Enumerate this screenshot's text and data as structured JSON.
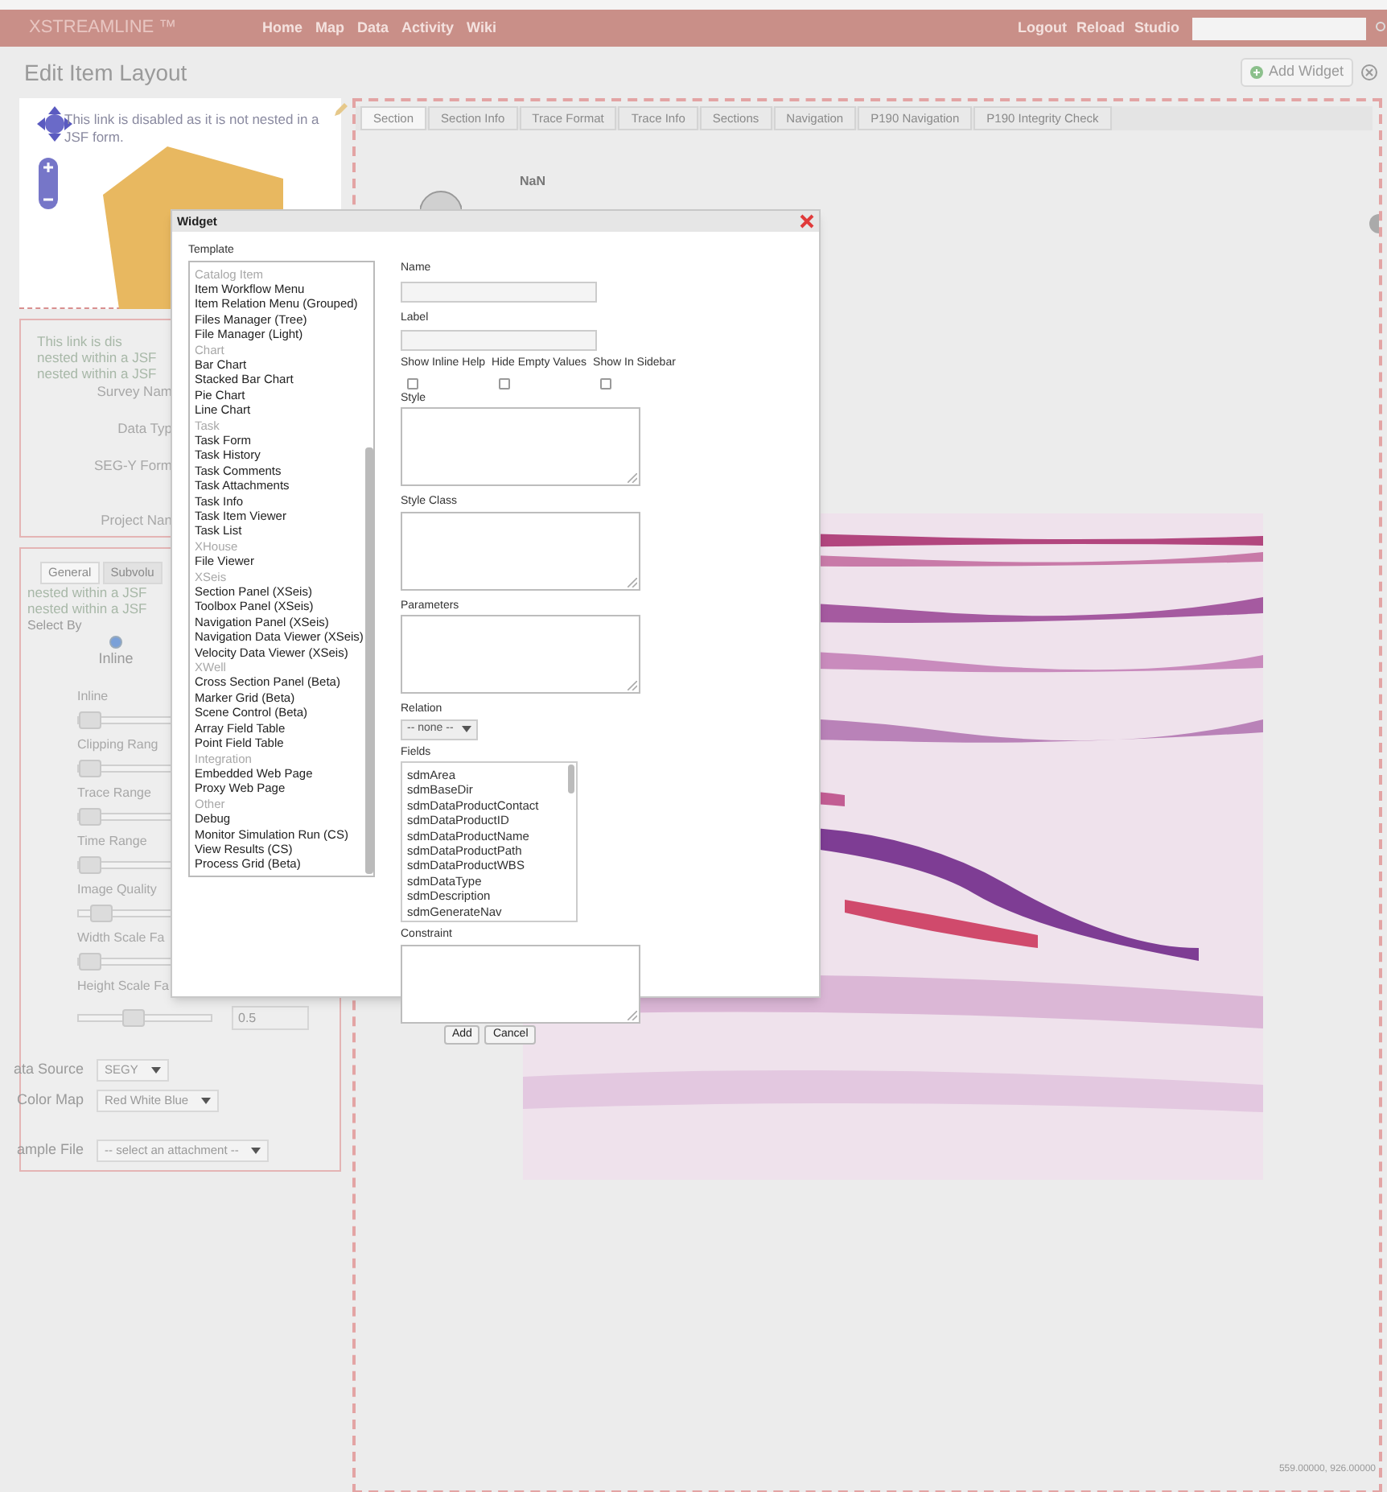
{
  "top_bar": {
    "logo": "XSTREAMLINE ™",
    "nav": [
      "Home",
      "Map",
      "Data",
      "Activity",
      "Wiki"
    ],
    "links": [
      "Logout",
      "Reload",
      "Studio"
    ]
  },
  "header": {
    "title": "Edit Item Layout",
    "add_widget": "Add Widget"
  },
  "map_panel": {
    "notice": "This link is disabled as it is not nested in a JSF form."
  },
  "info_panel": {
    "notices": [
      "This link is dis",
      "nested within a JSF",
      "nested within a JSF"
    ],
    "fields": [
      "Survey Nam",
      "Data Typ",
      "SEG-Y Form",
      "Project Nan"
    ]
  },
  "controls_panel": {
    "tabs": [
      {
        "label": "General",
        "selected": true
      },
      {
        "label": "Subvolu",
        "selected": false
      }
    ],
    "notices": [
      "nested within a JSF",
      "nested within a JSF"
    ],
    "select_by": "Select By",
    "radio": {
      "label": "Inline",
      "selected": true
    },
    "sliders": [
      {
        "label": "Inline",
        "level": 0
      },
      {
        "label": "Clipping Rang",
        "level": 0
      },
      {
        "label": "Trace Range",
        "level": 0
      },
      {
        "label": "Time Range",
        "level": 0
      },
      {
        "label": "Image Quality",
        "level": 0.1
      },
      {
        "label": "Width Scale Fa",
        "level": 0
      },
      {
        "label": "Height Scale Fa",
        "level": 0.4,
        "reading": "0.5"
      }
    ],
    "selects": [
      {
        "label": "ata Source",
        "value": "SEGY"
      },
      {
        "label": "Color Map",
        "value": "Red White Blue"
      },
      {
        "label": "ample File",
        "value": "-- select an attachment --"
      }
    ]
  },
  "section_panel": {
    "tabs": [
      {
        "label": "Section",
        "selected": true
      },
      {
        "label": "Section Info",
        "selected": false
      },
      {
        "label": "Trace Format",
        "selected": false
      },
      {
        "label": "Trace Info",
        "selected": false
      },
      {
        "label": "Sections",
        "selected": false
      },
      {
        "label": "Navigation",
        "selected": false
      },
      {
        "label": "P190 Navigation",
        "selected": false
      },
      {
        "label": "P190 Integrity Check",
        "selected": false
      }
    ],
    "value": "NaN",
    "coords": "559.00000, 926.00000"
  },
  "dialog": {
    "title": "Widget",
    "template_label": "Template",
    "templates": [
      {
        "kind": "group",
        "label": "Catalog Item"
      },
      {
        "kind": "item",
        "label": "Item Workflow Menu"
      },
      {
        "kind": "item",
        "label": "Item Relation Menu (Grouped)"
      },
      {
        "kind": "item",
        "label": "Files Manager (Tree)"
      },
      {
        "kind": "item",
        "label": "File Manager (Light)"
      },
      {
        "kind": "group",
        "label": "Chart"
      },
      {
        "kind": "item",
        "label": "Bar Chart"
      },
      {
        "kind": "item",
        "label": "Stacked Bar Chart"
      },
      {
        "kind": "item",
        "label": "Pie Chart"
      },
      {
        "kind": "item",
        "label": "Line Chart"
      },
      {
        "kind": "group",
        "label": "Task"
      },
      {
        "kind": "item",
        "label": "Task Form"
      },
      {
        "kind": "item",
        "label": "Task History"
      },
      {
        "kind": "item",
        "label": "Task Comments"
      },
      {
        "kind": "item",
        "label": "Task Attachments"
      },
      {
        "kind": "item",
        "label": "Task Info"
      },
      {
        "kind": "item",
        "label": "Task Item Viewer"
      },
      {
        "kind": "item",
        "label": "Task List"
      },
      {
        "kind": "group",
        "label": "XHouse"
      },
      {
        "kind": "item",
        "label": "File Viewer"
      },
      {
        "kind": "group",
        "label": "XSeis"
      },
      {
        "kind": "item",
        "label": "Section Panel (XSeis)"
      },
      {
        "kind": "item",
        "label": "Toolbox Panel (XSeis)"
      },
      {
        "kind": "item",
        "label": "Navigation Panel (XSeis)"
      },
      {
        "kind": "item",
        "label": "Navigation Data Viewer (XSeis)"
      },
      {
        "kind": "item",
        "label": "Velocity Data Viewer (XSeis)"
      },
      {
        "kind": "group",
        "label": "XWell"
      },
      {
        "kind": "item",
        "label": "Cross Section Panel (Beta)"
      },
      {
        "kind": "item",
        "label": "Marker Grid (Beta)"
      },
      {
        "kind": "item",
        "label": "Scene Control (Beta)"
      },
      {
        "kind": "item",
        "label": "Array Field Table"
      },
      {
        "kind": "item",
        "label": "Point Field Table"
      },
      {
        "kind": "group",
        "label": "Integration"
      },
      {
        "kind": "item",
        "label": "Embedded Web Page"
      },
      {
        "kind": "item",
        "label": "Proxy Web Page"
      },
      {
        "kind": "group",
        "label": "Other"
      },
      {
        "kind": "item",
        "label": "Debug"
      },
      {
        "kind": "item",
        "label": "Monitor Simulation Run (CS)"
      },
      {
        "kind": "item",
        "label": "View Results (CS)"
      },
      {
        "kind": "item",
        "label": "Process Grid (Beta)"
      }
    ],
    "name_label": "Name",
    "label_label": "Label",
    "checkboxes": [
      {
        "label": "Show Inline Help",
        "checked": false
      },
      {
        "label": "Hide Empty Values",
        "checked": false
      },
      {
        "label": "Show In Sidebar",
        "checked": false
      }
    ],
    "style_label": "Style",
    "style_class_label": "Style Class",
    "parameters_label": "Parameters",
    "relation_label": "Relation",
    "relation_value": "-- none --",
    "fields_label": "Fields",
    "fields": [
      "sdmArea",
      "sdmBaseDir",
      "sdmDataProductContact",
      "sdmDataProductID",
      "sdmDataProductName",
      "sdmDataProductPath",
      "sdmDataProductWBS",
      "sdmDataType",
      "sdmDescription",
      "sdmGenerateNav"
    ],
    "constraint_label": "Constraint",
    "buttons": [
      "Add",
      "Cancel"
    ]
  }
}
